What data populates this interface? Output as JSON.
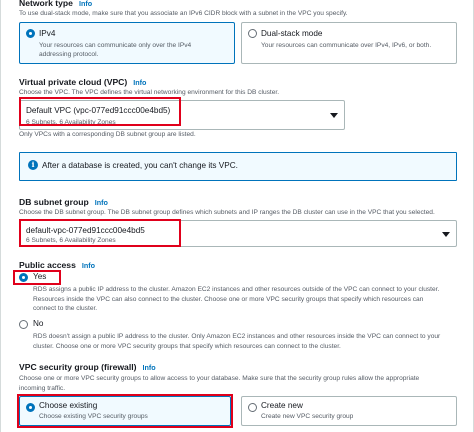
{
  "network_type": {
    "label": "Network type",
    "info": "Info",
    "description": "To use dual-stack mode, make sure that you associate an IPv6 CIDR block with a subnet in the VPC you specify.",
    "options": [
      {
        "label": "IPv4",
        "description_1": "Your resources can communicate only over the IPv4",
        "description_2": "addressing protocol.",
        "selected": true
      },
      {
        "label": "Dual-stack mode",
        "description_1": "Your resources can communicate over IPv4, IPv6, or both.",
        "description_2": "",
        "selected": false
      }
    ]
  },
  "vpc": {
    "label": "Virtual private cloud (VPC)",
    "info": "Info",
    "description": "Choose the VPC. The VPC defines the virtual networking environment for this DB cluster.",
    "value": "Default VPC (vpc-077ed91ccc00e4bd5)",
    "meta": "6 Subnets, 6 Availability Zones",
    "hint": "Only VPCs with a corresponding DB subnet group are listed."
  },
  "alert": {
    "text": "After a database is created, you can't change its VPC."
  },
  "subnet_group": {
    "label": "DB subnet group",
    "info": "Info",
    "description": "Choose the DB subnet group. The DB subnet group defines which subnets and IP ranges the DB cluster can use in the VPC that you selected.",
    "value": "default-vpc-077ed91ccc00e4bd5",
    "meta": "6 Subnets, 6 Availability Zones"
  },
  "public_access": {
    "label": "Public access",
    "info": "Info",
    "yes": {
      "label": "Yes",
      "desc_1": "RDS assigns a public IP address to the cluster. Amazon EC2 instances and other resources outside of the VPC can connect to your cluster.",
      "desc_2": "Resources inside the VPC can also connect to the cluster. Choose one or more VPC security groups that specify which resources can",
      "desc_3": "connect to the cluster."
    },
    "no": {
      "label": "No",
      "desc_1": "RDS doesn't assign a public IP address to the cluster. Only Amazon EC2 instances and other resources inside the VPC can connect to your",
      "desc_2": "cluster. Choose one or more VPC security groups that specify which resources can connect to the cluster."
    }
  },
  "security_group": {
    "label": "VPC security group (firewall)",
    "info": "Info",
    "description_1": "Choose one or more VPC security groups to allow access to your database. Make sure that the security group rules allow the appropriate",
    "description_2": "incoming traffic.",
    "options": [
      {
        "label": "Choose existing",
        "description": "Choose existing VPC security groups",
        "selected": true
      },
      {
        "label": "Create new",
        "description": "Create new VPC security group",
        "selected": false
      }
    ]
  }
}
